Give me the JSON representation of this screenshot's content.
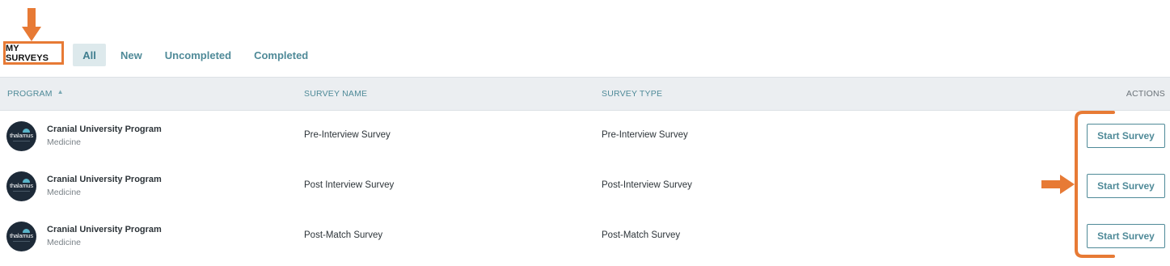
{
  "header": {
    "my_surveys_label": "MY SURVEYS"
  },
  "tabs": [
    {
      "label": "All",
      "active": true
    },
    {
      "label": "New",
      "active": false
    },
    {
      "label": "Uncompleted",
      "active": false
    },
    {
      "label": "Completed",
      "active": false
    }
  ],
  "table": {
    "columns": {
      "program": "PROGRAM",
      "survey_name": "SURVEY NAME",
      "survey_type": "SURVEY TYPE",
      "actions": "ACTIONS"
    },
    "sort_icon": "sort-ascending-icon",
    "rows": [
      {
        "logo_text": "thalamus",
        "program": "Cranial University Program",
        "specialty": "Medicine",
        "survey_name": "Pre-Interview Survey",
        "survey_type": "Pre-Interview Survey",
        "action_label": "Start Survey"
      },
      {
        "logo_text": "thalamus",
        "program": "Cranial University Program",
        "specialty": "Medicine",
        "survey_name": "Post Interview Survey",
        "survey_type": "Post-Interview Survey",
        "action_label": "Start Survey"
      },
      {
        "logo_text": "thalamus",
        "program": "Cranial University Program",
        "specialty": "Medicine",
        "survey_name": "Post-Match Survey",
        "survey_type": "Post-Match Survey",
        "action_label": "Start Survey"
      }
    ]
  },
  "colors": {
    "annotation": "#e77a35",
    "accent": "#4f8a98",
    "header_bg": "#ebeef1",
    "active_tab_bg": "#dde9ec",
    "logo_bg": "#1d2a38"
  }
}
